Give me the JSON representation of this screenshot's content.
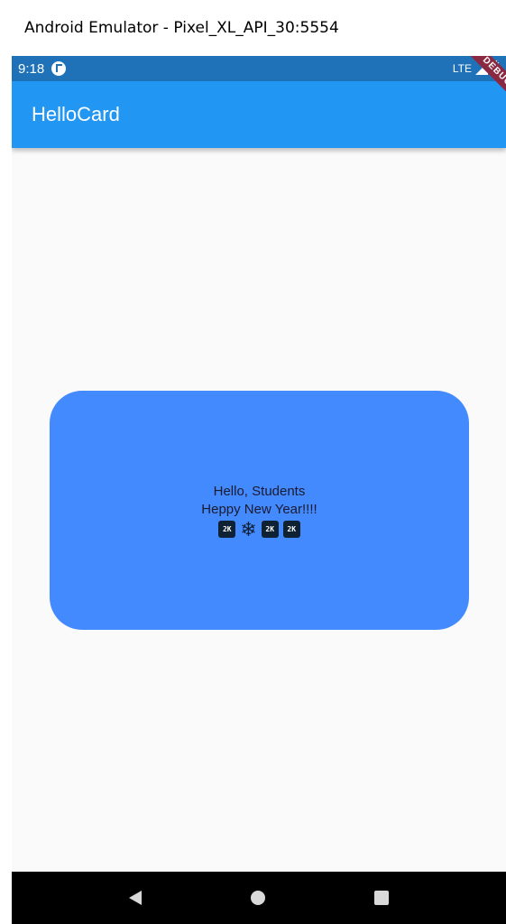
{
  "window": {
    "title": "Android Emulator - Pixel_XL_API_30:5554"
  },
  "status_bar": {
    "time": "9:18",
    "network": "LTE",
    "color": "#1f72b8"
  },
  "app_bar": {
    "title": "HelloCard",
    "color": "#2196f3"
  },
  "debug_banner": {
    "label": "DEBUG"
  },
  "card": {
    "line1": "Hello, Students",
    "line2": "Heppy New Year!!!!",
    "emoji": [
      "2K",
      "snowflake-icon",
      "2K",
      "2K"
    ],
    "color": "#448aff"
  },
  "nav_bar": {
    "buttons": [
      "back-icon",
      "home-icon",
      "recent-apps-icon"
    ]
  }
}
